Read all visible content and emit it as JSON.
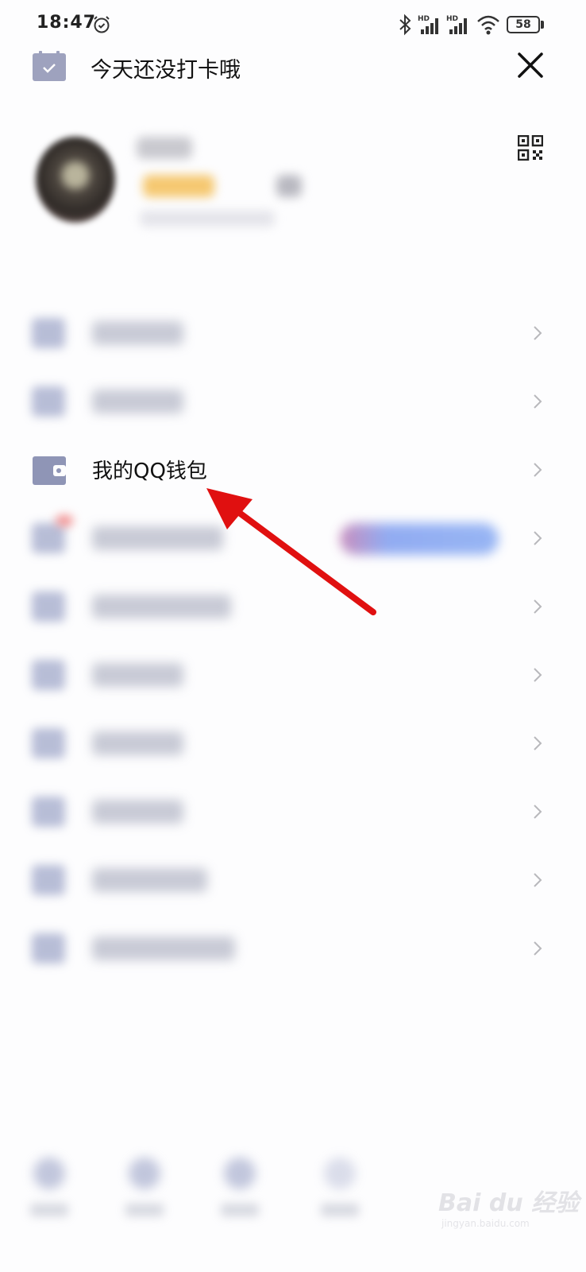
{
  "status_bar": {
    "time": "18:47",
    "battery": "58",
    "icons": [
      "alarm-icon",
      "bluetooth-icon",
      "hd-signal-icon",
      "hd-signal-icon",
      "wifi-icon",
      "battery-icon"
    ]
  },
  "header": {
    "checkin_text": "今天还没打卡哦",
    "calendar_icon": "calendar-check-icon",
    "close_icon": "close-icon"
  },
  "profile": {
    "qr_icon": "qr-code-icon"
  },
  "menu": {
    "items": [
      {
        "label": "",
        "icon": "menu-icon",
        "blurred": true
      },
      {
        "label": "",
        "icon": "menu-icon",
        "blurred": true
      },
      {
        "label": "我的QQ钱包",
        "icon": "wallet-icon",
        "blurred": false
      },
      {
        "label": "",
        "icon": "menu-icon",
        "blurred": true
      },
      {
        "label": "",
        "icon": "menu-icon",
        "blurred": true
      },
      {
        "label": "",
        "icon": "menu-icon",
        "blurred": true
      },
      {
        "label": "",
        "icon": "menu-icon",
        "blurred": true
      },
      {
        "label": "",
        "icon": "menu-icon",
        "blurred": true
      },
      {
        "label": "",
        "icon": "menu-icon",
        "blurred": true
      },
      {
        "label": "",
        "icon": "menu-icon",
        "blurred": true
      }
    ]
  },
  "annotation": {
    "arrow_color": "#e01010"
  },
  "watermark": {
    "text": "Bai du 经验",
    "sub": "jingyan.baidu.com"
  }
}
